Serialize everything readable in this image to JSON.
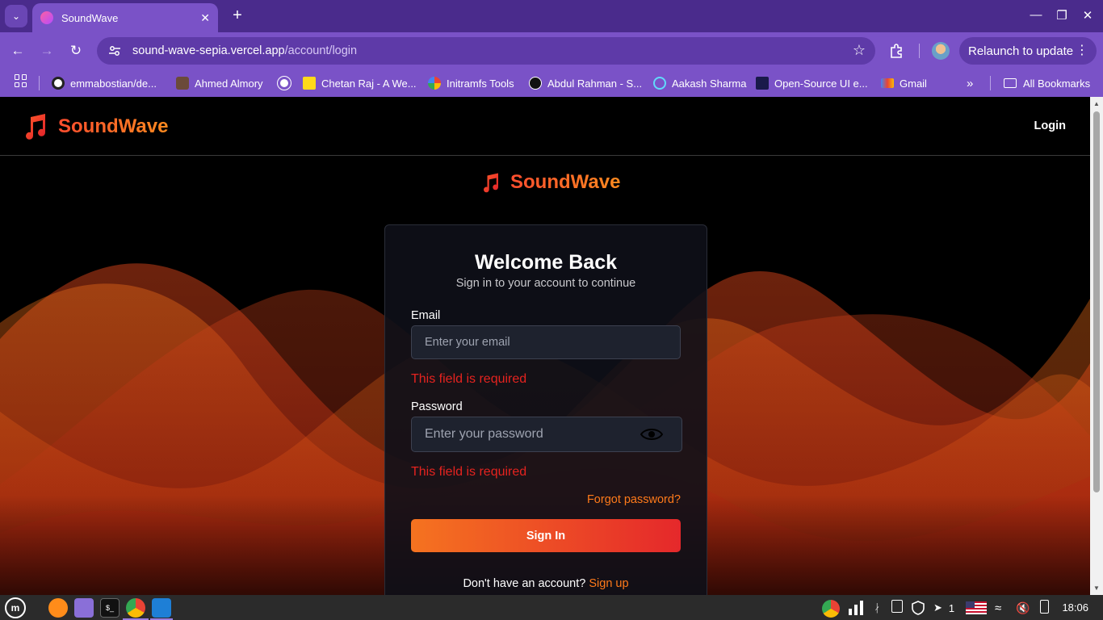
{
  "browser": {
    "tab_title": "SoundWave",
    "url_host": "sound-wave-sepia.vercel.app",
    "url_path": "/account/login",
    "relaunch_label": "Relaunch to update",
    "bookmarks": [
      {
        "label": "emmabostian/de...",
        "icon": "github-icon"
      },
      {
        "label": "Ahmed Almory",
        "icon": "person-icon"
      },
      {
        "label": "",
        "icon": "globe-icon"
      },
      {
        "label": "Chetan Raj - A We...",
        "icon": "yellow-square-icon"
      },
      {
        "label": "Initramfs Tools",
        "icon": "google-icon"
      },
      {
        "label": "Abdul Rahman - S...",
        "icon": "a-logo-icon"
      },
      {
        "label": "Aakash Sharma",
        "icon": "react-icon"
      },
      {
        "label": "Open-Source UI e...",
        "icon": "ui-icon"
      },
      {
        "label": "Gmail",
        "icon": "gmail-icon"
      }
    ],
    "all_bookmarks_label": "All Bookmarks"
  },
  "site": {
    "brand": "SoundWave",
    "nav_login": "Login",
    "center_brand": "SoundWave"
  },
  "login": {
    "title": "Welcome Back",
    "subtitle": "Sign in to your account to continue",
    "email_label": "Email",
    "email_placeholder": "Enter your email",
    "email_value": "",
    "email_error": "This field is required",
    "password_label": "Password",
    "password_placeholder": "Enter your password",
    "password_value": "",
    "password_error": "This field is required",
    "forgot": "Forgot password?",
    "signin": "Sign In",
    "no_account": "Don't have an account?",
    "signup": "Sign up"
  },
  "taskbar": {
    "notif_count": "1",
    "time": "18:06"
  },
  "colors": {
    "chrome": "#7a52c7",
    "accent_orange": "#ff7a1a",
    "accent_red": "#e5282b",
    "error": "#e5231f"
  }
}
